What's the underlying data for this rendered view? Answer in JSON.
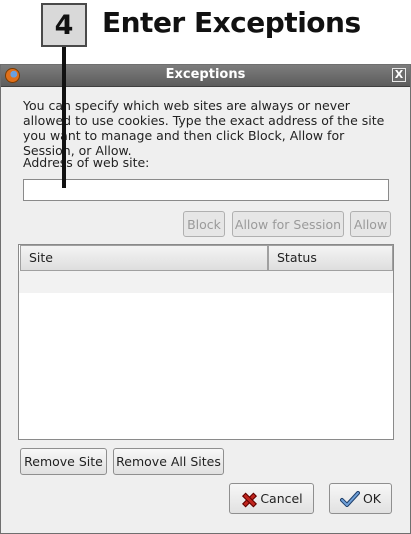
{
  "callout": {
    "step_number": "4",
    "step_title": "Enter Exceptions"
  },
  "window": {
    "title": "Exceptions",
    "close_label": "X"
  },
  "dialog": {
    "description": "You can specify which web sites are always or never allowed to use cookies. Type the exact address of the site you want to manage and then click Block, Allow for Session, or Allow.",
    "address_label": "Address of web site:",
    "address_value": "",
    "address_placeholder": ""
  },
  "actions": {
    "block": "Block",
    "allow_session": "Allow for Session",
    "allow": "Allow",
    "actions_enabled": false
  },
  "table": {
    "columns": [
      "Site",
      "Status"
    ],
    "rows": []
  },
  "bottom_buttons": {
    "remove_site": "Remove Site",
    "remove_all_sites": "Remove All Sites",
    "cancel": "Cancel",
    "ok": "OK"
  },
  "icons": {
    "app": "firefox-icon",
    "cancel": "x-icon",
    "ok": "checkmark-icon"
  },
  "colors": {
    "titlebar": "#6b6b6b",
    "window_bg": "#efefef",
    "disabled_text": "#9a9a9a",
    "cancel_icon": "#c0241d",
    "ok_icon": "#3a6ea8"
  }
}
